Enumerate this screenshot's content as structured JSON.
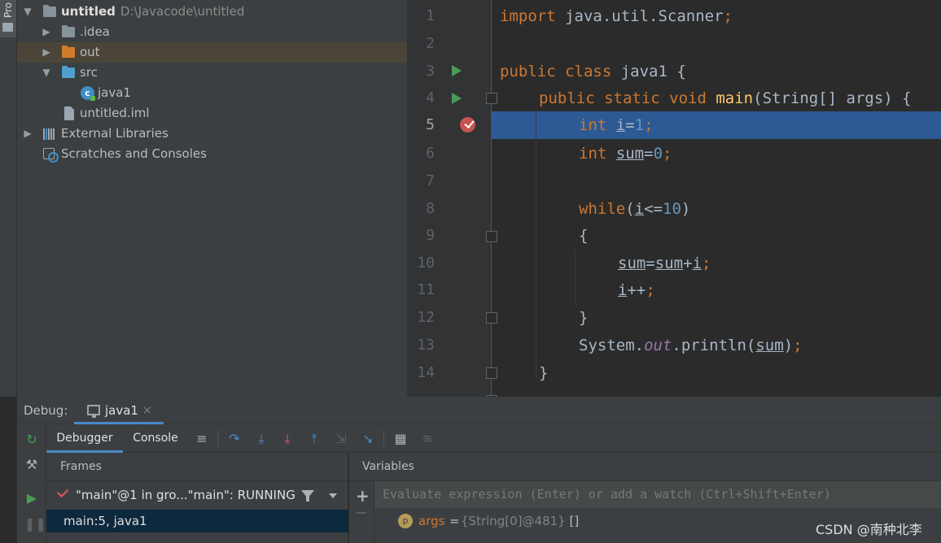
{
  "project_stripe": {
    "label": "Pro"
  },
  "tree": {
    "root": {
      "name": "untitled",
      "path": "D:\\Javacode\\untitled"
    },
    "items": [
      {
        "name": ".idea"
      },
      {
        "name": "out"
      },
      {
        "name": "src"
      },
      {
        "name": "java1"
      },
      {
        "name": "untitled.iml"
      },
      {
        "name": "External Libraries"
      },
      {
        "name": "Scratches and Consoles"
      }
    ]
  },
  "editor": {
    "line_numbers": [
      "1",
      "2",
      "3",
      "4",
      "5",
      "6",
      "7",
      "8",
      "9",
      "10",
      "11",
      "12",
      "13",
      "14"
    ],
    "current_line": 5,
    "lines": {
      "l1_kw": "import",
      "l1_rest": " java.util.Scanner",
      "l1_semi": ";",
      "l3_kw": "public class",
      "l3_rest": " java1 {",
      "l4_kw": "public static void",
      "l4_fn": "main",
      "l4_rest": "(String[] args) {",
      "l5_kw": "int",
      "l5_var": "i",
      "l5_eq": "=",
      "l5_num": "1",
      "l5_semi": ";",
      "l6_kw": "int",
      "l6_var": "sum",
      "l6_eq": "=",
      "l6_num": "0",
      "l6_semi": ";",
      "l8_kw": "while",
      "l8_open": "(",
      "l8_var": "i",
      "l8_op": "<=",
      "l8_num": "10",
      "l8_close": ")",
      "l9": "{",
      "l10_v1": "sum",
      "l10_eq": "=",
      "l10_v2": "sum",
      "l10_plus": "+",
      "l10_v3": "i",
      "l10_semi": ";",
      "l11_var": "i",
      "l11_op": "++",
      "l11_semi": ";",
      "l12": "}",
      "l13_a": "System.",
      "l13_out": "out",
      "l13_b": ".println(",
      "l13_var": "sum",
      "l13_c": ")",
      "l13_semi": ";",
      "l14": "}"
    }
  },
  "debug": {
    "title": "Debug:",
    "tab": "java1",
    "tab_close": "×",
    "subtabs": {
      "debugger": "Debugger",
      "console": "Console"
    },
    "frames_header": "Frames",
    "thread": "\"main\"@1 in gro...\"main\": RUNNING",
    "frame": "main:5, java1",
    "variables_header": "Variables",
    "watch_placeholder": "Evaluate expression (Enter) or add a watch (Ctrl+Shift+Enter)",
    "variable": {
      "badge": "p",
      "name": "args",
      "eq": "=",
      "value": "{String[0]@481}",
      "extra": "[]"
    }
  },
  "watermark": "CSDN @南种北李",
  "colors": {
    "selection": "#2d5a94",
    "keyword": "#cc7832",
    "number": "#6897bb",
    "method": "#ffc66d",
    "breakpoint": "#c75450",
    "run": "#499c54"
  }
}
